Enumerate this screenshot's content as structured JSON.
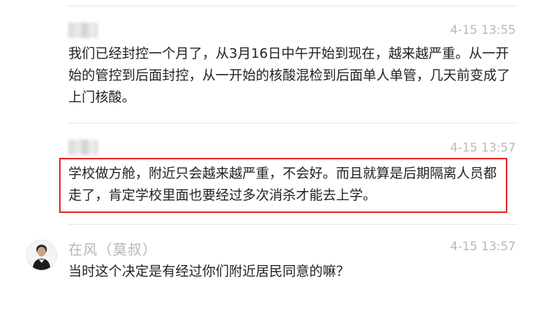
{
  "comments": [
    {
      "username": "",
      "time": "4-15 13:55",
      "text": "我们已经封控一个月了，从3月16日中午开始到现在，越来越严重。从一开始的管控到后面封控，从一开始的核酸混检到后面单人单管，几天前变成了上门核酸。"
    },
    {
      "username": "",
      "time": "4-15 13:57",
      "text": "学校做方舱，附近只会越来越严重，不会好。而且就算是后期隔离人员都走了，肯定学校里面也要经过多次消杀才能去上学。",
      "highlight_color": "#e02020"
    },
    {
      "username": "在风（莫叔）",
      "time": "4-15 13:57",
      "text": "当时这个决定是有经过你们附近居民同意的嘛？"
    }
  ]
}
